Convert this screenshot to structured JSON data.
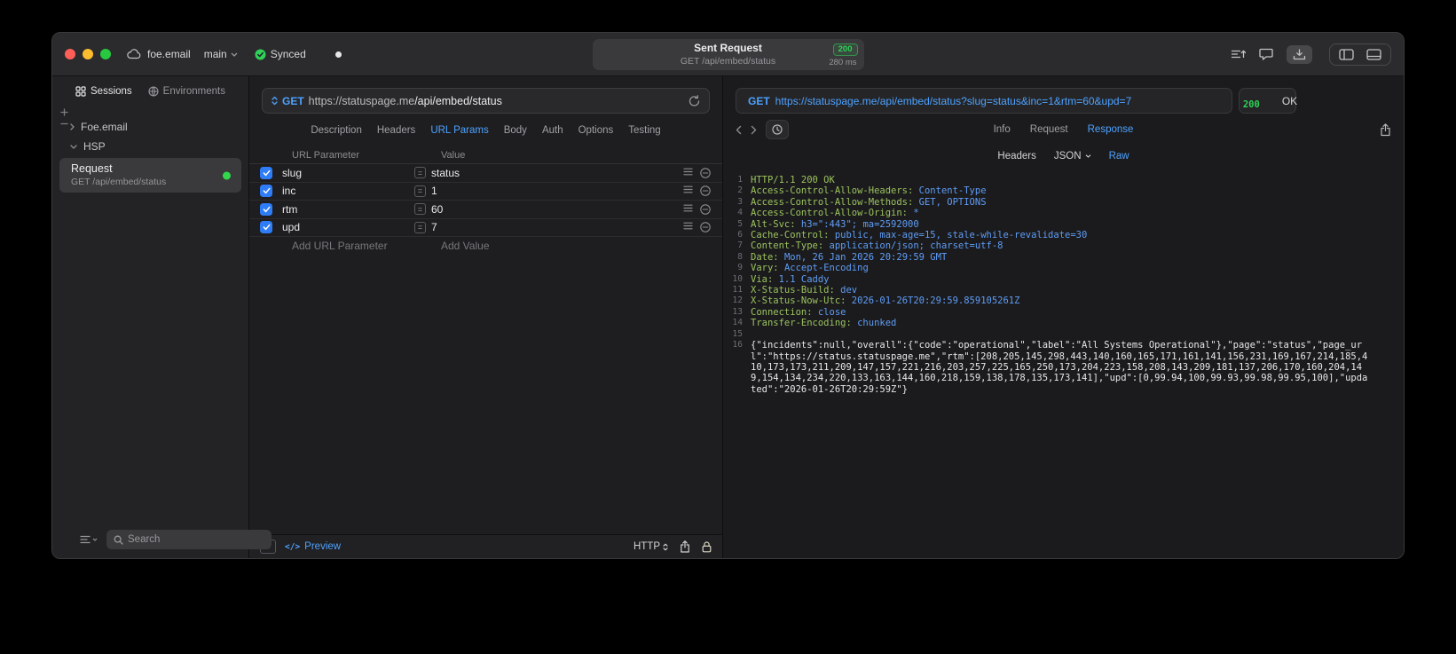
{
  "colors": {
    "accent_blue": "#4da2ff",
    "success_green": "#30d158",
    "header_name_green": "#9cc35e",
    "header_value_blue": "#5f9df6",
    "checkbox_blue": "#2f7cf7"
  },
  "titlebar": {
    "project": "foe.email",
    "branch": "main",
    "sync_label": "Synced",
    "request_pill": {
      "title": "Sent Request",
      "status_code": "200",
      "request_line": "GET /api/embed/status",
      "duration": "280 ms"
    }
  },
  "sidebar": {
    "tabs": [
      {
        "label": "Sessions"
      },
      {
        "label": "Environments"
      }
    ],
    "tree": {
      "group1": "Foe.email",
      "group2": "HSP",
      "request": {
        "title": "Request",
        "subtitle": "GET /api/embed/status"
      }
    },
    "search": {
      "placeholder": "Search"
    }
  },
  "request_panel": {
    "method": "GET",
    "url_host": "https://statuspage.me",
    "url_path": "/api/embed/status",
    "tabs": [
      "Description",
      "Headers",
      "URL Params",
      "Body",
      "Auth",
      "Options",
      "Testing"
    ],
    "active_tab": "URL Params",
    "params": {
      "col_name": "URL Parameter",
      "col_value": "Value",
      "rows": [
        {
          "name": "slug",
          "value": "status",
          "enabled": true
        },
        {
          "name": "inc",
          "value": "1",
          "enabled": true
        },
        {
          "name": "rtm",
          "value": "60",
          "enabled": true
        },
        {
          "name": "upd",
          "value": "7",
          "enabled": true
        }
      ],
      "add_name": "Add URL Parameter",
      "add_value": "Add Value"
    },
    "footer": {
      "preview": "Preview",
      "protocol": "HTTP"
    }
  },
  "response_panel": {
    "method": "GET",
    "url": "https://statuspage.me/api/embed/status?slug=status&inc=1&rtm=60&upd=7",
    "status_code": "200",
    "status_text": "OK",
    "tabs": [
      "Info",
      "Request",
      "Response"
    ],
    "active_tab": "Response",
    "subtabs": [
      "Headers",
      "JSON",
      "Raw"
    ],
    "active_subtab": "Raw",
    "lines": [
      {
        "num": 1,
        "type": "status",
        "text": "HTTP/1.1 200 OK"
      },
      {
        "num": 2,
        "type": "header",
        "name": "Access-Control-Allow-Headers",
        "value": "Content-Type"
      },
      {
        "num": 3,
        "type": "header",
        "name": "Access-Control-Allow-Methods",
        "value": "GET, OPTIONS"
      },
      {
        "num": 4,
        "type": "header",
        "name": "Access-Control-Allow-Origin",
        "value": "*"
      },
      {
        "num": 5,
        "type": "header",
        "name": "Alt-Svc",
        "value": "h3=\":443\"; ma=2592000"
      },
      {
        "num": 6,
        "type": "header",
        "name": "Cache-Control",
        "value": "public, max-age=15, stale-while-revalidate=30"
      },
      {
        "num": 7,
        "type": "header",
        "name": "Content-Type",
        "value": "application/json; charset=utf-8"
      },
      {
        "num": 8,
        "type": "header",
        "name": "Date",
        "value": "Mon, 26 Jan 2026 20:29:59 GMT"
      },
      {
        "num": 9,
        "type": "header",
        "name": "Vary",
        "value": "Accept-Encoding"
      },
      {
        "num": 10,
        "type": "header",
        "name": "Via",
        "value": "1.1 Caddy"
      },
      {
        "num": 11,
        "type": "header",
        "name": "X-Status-Build",
        "value": "dev"
      },
      {
        "num": 12,
        "type": "header",
        "name": "X-Status-Now-Utc",
        "value": "2026-01-26T20:29:59.859105261Z"
      },
      {
        "num": 13,
        "type": "header",
        "name": "Connection",
        "value": "close"
      },
      {
        "num": 14,
        "type": "header",
        "name": "Transfer-Encoding",
        "value": "chunked"
      },
      {
        "num": 15,
        "type": "blank"
      },
      {
        "num": 16,
        "type": "body",
        "text": "{\"incidents\":null,\"overall\":{\"code\":\"operational\",\"label\":\"All Systems Operational\"},\"page\":\"status\",\"page_url\":\"https://status.statuspage.me\",\"rtm\":[208,205,145,298,443,140,160,165,171,161,141,156,231,169,167,214,185,410,173,173,211,209,147,157,221,216,203,257,225,165,250,173,204,223,158,208,143,209,181,137,206,170,160,204,149,154,134,234,220,133,163,144,160,218,159,138,178,135,173,141],\"upd\":[0,99.94,100,99.93,99.98,99.95,100],\"updated\":\"2026-01-26T20:29:59Z\"}"
      }
    ]
  }
}
